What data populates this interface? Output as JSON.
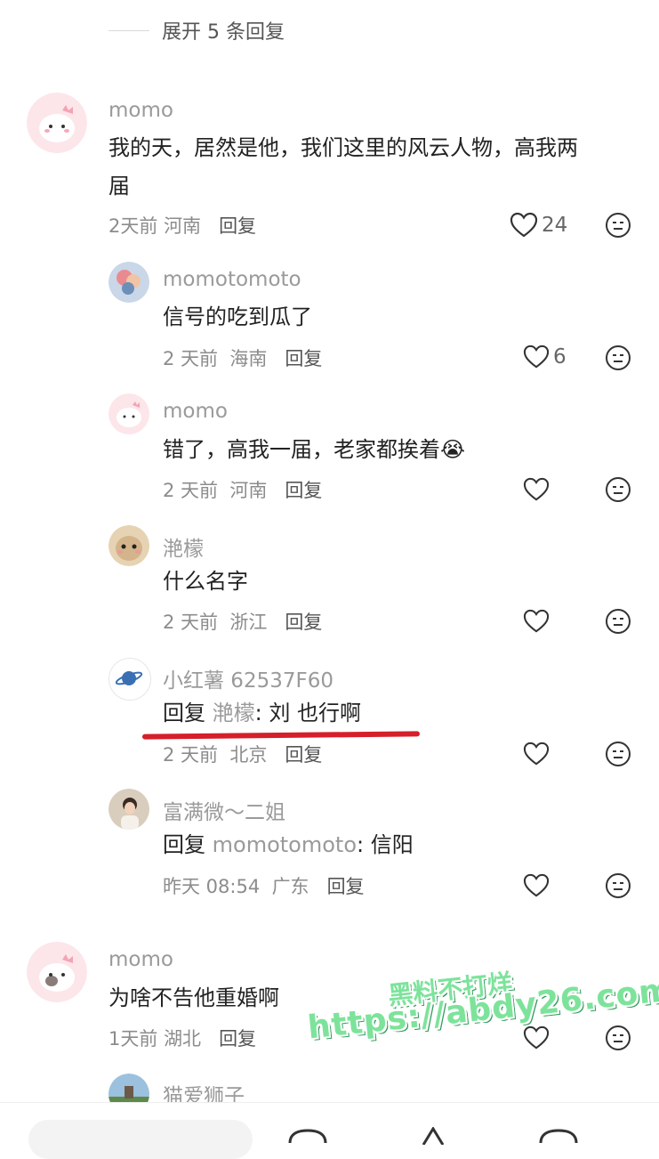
{
  "expand_replies": "展开 5 条回复",
  "colors": {
    "username": "#9a9a9a",
    "text": "#222222",
    "meta": "#8c8c8c",
    "underline": "#d51f2a",
    "watermark": "#7de39b"
  },
  "comments": [
    {
      "user": "momo",
      "text_line1": "我的天，居然是他，我们这里的风云人物，高我两",
      "text_line2": "届",
      "time": "2天前",
      "location": "河南",
      "reply": "回复",
      "likes": "24"
    },
    {
      "user": "momotomoto",
      "text": "信号的吃到瓜了",
      "time": "2 天前",
      "location": "海南",
      "reply": "回复",
      "likes": "6"
    },
    {
      "user": "momo",
      "text": "错了，高我一届，老家都挨着",
      "emoji": "😭",
      "time": "2 天前",
      "location": "河南",
      "reply": "回复"
    },
    {
      "user": "滟檬",
      "text": "什么名字",
      "time": "2 天前",
      "location": "浙江",
      "reply": "回复"
    },
    {
      "user": "小红薯 62537F60",
      "reply_prefix": "回复",
      "reply_to": "滟檬",
      "text": ": 刘  也行啊",
      "time": "2 天前",
      "location": "北京",
      "reply": "回复"
    },
    {
      "user": "富满微～二姐",
      "reply_prefix": "回复",
      "reply_to": "momotomoto",
      "text": ": 信阳",
      "time": "昨天 08:54",
      "location": "广东",
      "reply": "回复"
    },
    {
      "user": "momo",
      "text": "为啥不告他重婚啊",
      "time": "1天前",
      "location": "湖北",
      "reply": "回复"
    },
    {
      "user": "猫爱狮子"
    }
  ],
  "watermark": {
    "line1": "黑料不打烊",
    "line2": "https://abdy26.com"
  },
  "icons": [
    "heart-icon",
    "dislike-face-icon",
    "planet-icon"
  ]
}
